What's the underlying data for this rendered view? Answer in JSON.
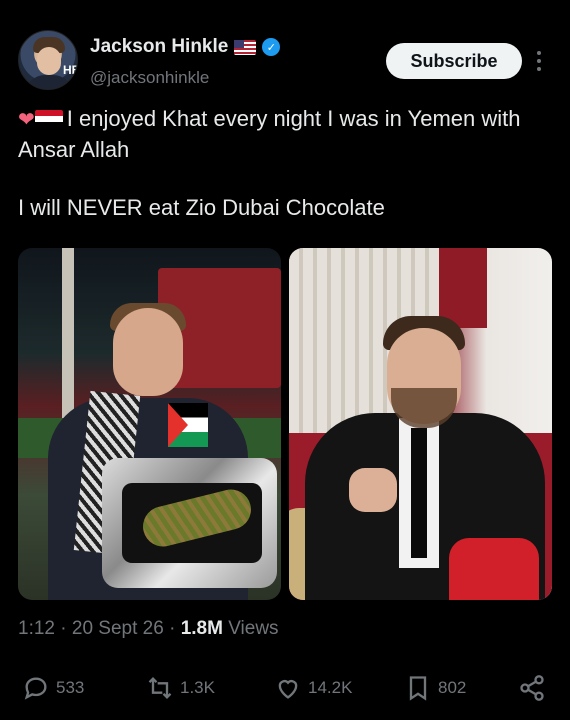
{
  "author": {
    "name": "Jackson Hinkle",
    "handle": "@jacksonhinkle",
    "avatar_tag": "HB"
  },
  "subscribe_label": "Subscribe",
  "tweet": {
    "line1": "I enjoyed Khat every night I was in Yemen with Ansar Allah",
    "line2": "I will NEVER eat Zio Dubai Chocolate"
  },
  "meta": {
    "time": "1:12",
    "date": "20 Sept 26",
    "views_count": "1.8M",
    "views_label": "Views"
  },
  "actions": {
    "replies": "533",
    "reposts": "1.3K",
    "likes": "14.2K",
    "bookmarks": "802"
  },
  "colors": {
    "background": "#000000",
    "text_primary": "#e7e9ea",
    "text_secondary": "#71767b",
    "verified": "#1d9bf0"
  }
}
